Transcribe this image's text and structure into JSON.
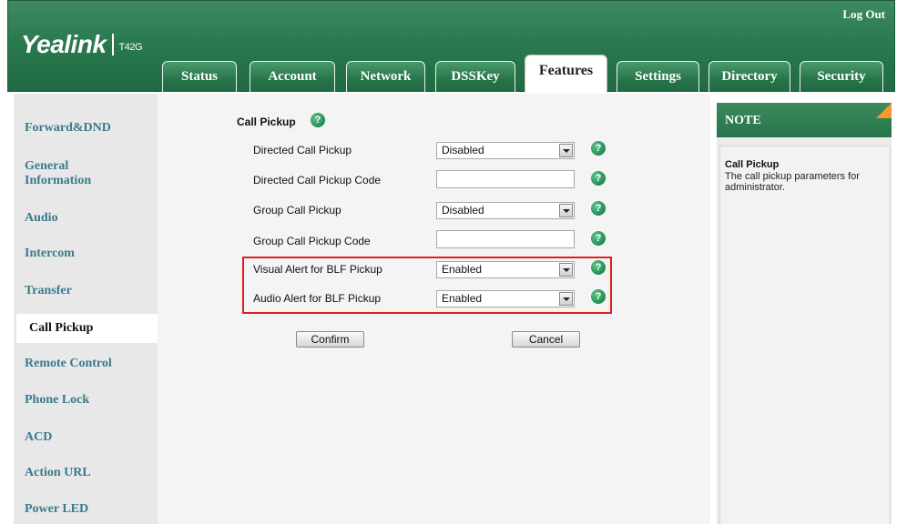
{
  "header": {
    "logout": "Log Out",
    "brand": "Yealink",
    "model": "T42G",
    "tabs": [
      {
        "label": "Status"
      },
      {
        "label": "Account"
      },
      {
        "label": "Network"
      },
      {
        "label": "DSSKey"
      },
      {
        "label": "Features",
        "active": true
      },
      {
        "label": "Settings"
      },
      {
        "label": "Directory"
      },
      {
        "label": "Security"
      }
    ]
  },
  "sidebar": {
    "items": [
      {
        "label": "Forward&DND"
      },
      {
        "label": "General\nInformation"
      },
      {
        "label": "Audio"
      },
      {
        "label": "Intercom"
      },
      {
        "label": "Transfer"
      },
      {
        "label": "Call Pickup",
        "active": true
      },
      {
        "label": "Remote Control"
      },
      {
        "label": "Phone Lock"
      },
      {
        "label": "ACD"
      },
      {
        "label": "Action URL"
      },
      {
        "label": "Power LED"
      }
    ]
  },
  "main": {
    "section_title": "Call Pickup",
    "fields": [
      {
        "label": "Directed Call Pickup",
        "type": "select",
        "value": "Disabled"
      },
      {
        "label": "Directed Call Pickup Code",
        "type": "input",
        "value": ""
      },
      {
        "label": "Group Call Pickup",
        "type": "select",
        "value": "Disabled"
      },
      {
        "label": "Group Call Pickup Code",
        "type": "input",
        "value": ""
      },
      {
        "label": "Visual Alert for BLF Pickup",
        "type": "select",
        "value": "Enabled"
      },
      {
        "label": "Audio Alert for BLF Pickup",
        "type": "select",
        "value": "Enabled"
      }
    ],
    "confirm_label": "Confirm",
    "cancel_label": "Cancel"
  },
  "note": {
    "header": "NOTE",
    "title": "Call Pickup",
    "text": "The call pickup parameters for administrator."
  },
  "colors": {
    "brand_green": "#2b7a4f",
    "link_teal": "#3a7a8c",
    "highlight_red": "#e02020",
    "note_corner": "#f39a2b"
  }
}
